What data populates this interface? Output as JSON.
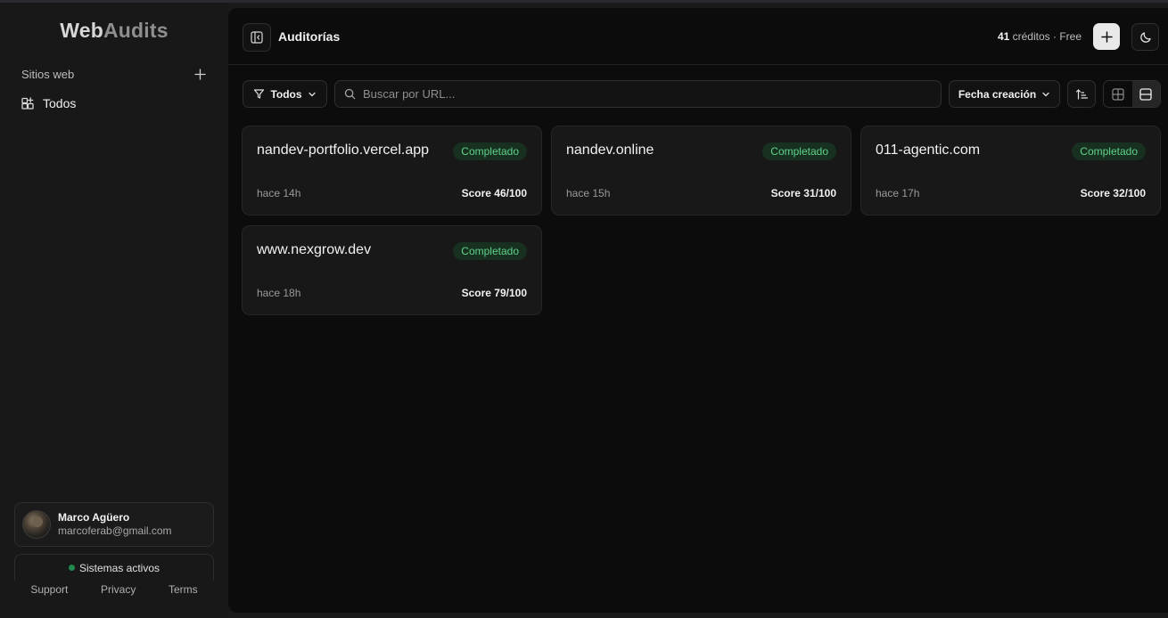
{
  "sidebar": {
    "logo": {
      "part1": "Web",
      "part2": "Audits"
    },
    "section_label": "Sitios web",
    "nav_item": "Todos",
    "user": {
      "name": "Marco Agüero",
      "email": "marcoferab@gmail.com"
    },
    "status": "Sistemas activos",
    "links": {
      "support": "Support",
      "privacy": "Privacy",
      "terms": "Terms"
    }
  },
  "header": {
    "title": "Auditorías",
    "credits_count": "41",
    "credits_label": "créditos · Free"
  },
  "toolbar": {
    "filter_label": "Todos",
    "search_placeholder": "Buscar por URL...",
    "sort_label": "Fecha creación"
  },
  "audits": [
    {
      "domain": "nandev-portfolio.vercel.app",
      "status": "Completado",
      "time": "hace 14h",
      "score": "Score 46/100"
    },
    {
      "domain": "nandev.online",
      "status": "Completado",
      "time": "hace 15h",
      "score": "Score 31/100"
    },
    {
      "domain": "011-agentic.com",
      "status": "Completado",
      "time": "hace 17h",
      "score": "Score 32/100"
    },
    {
      "domain": "www.nexgrow.dev",
      "status": "Completado",
      "time": "hace 18h",
      "score": "Score 79/100"
    }
  ],
  "colors": {
    "status_green": "#5fd38a",
    "status_bg": "#17301f",
    "online_dot": "#1f8a4c"
  }
}
